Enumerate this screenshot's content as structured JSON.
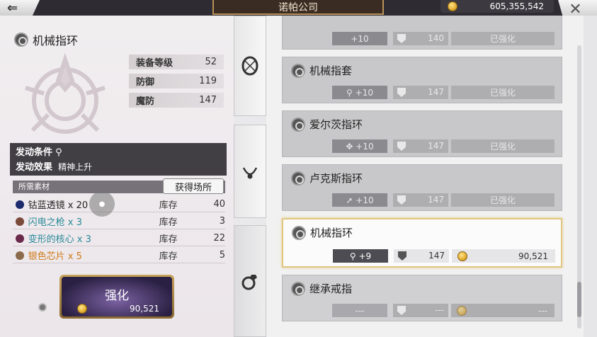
{
  "header": {
    "back_label": "⇐",
    "title": "诺帕公司",
    "currency": "605,355,542",
    "close_label": "✕"
  },
  "item": {
    "name": "机械指环",
    "stats": [
      {
        "label": "装备等级",
        "value": "52"
      },
      {
        "label": "防御",
        "value": "119"
      },
      {
        "label": "魔防",
        "value": "147"
      }
    ],
    "condition_label": "发动条件",
    "effect_label": "发动效果",
    "effect_value": "精神上升"
  },
  "materials": {
    "header": "所需素材",
    "get_button": "获得场所",
    "rows": [
      {
        "name": "钴蓝透镜 x 20",
        "stock_label": "库存",
        "qty": "40",
        "color": "#222222",
        "orb": "#1c2a6e"
      },
      {
        "name": "闪电之枪 x 3",
        "stock_label": "库存",
        "qty": "3",
        "color": "#2a8a9a",
        "orb": "#7a4a3a"
      },
      {
        "name": "变形的核心 x 3",
        "stock_label": "库存",
        "qty": "22",
        "color": "#2a8a9a",
        "orb": "#6a2a4a"
      },
      {
        "name": "银色芯片 x 5",
        "stock_label": "库存",
        "qty": "5",
        "color": "#d07a1a",
        "orb": "#8a6a4a"
      }
    ]
  },
  "enhance": {
    "label": "强化",
    "cost": "90,521"
  },
  "list": {
    "cards": [
      {
        "name": "",
        "level": "+10",
        "defense": "140",
        "status": "已强化"
      },
      {
        "name": "机械指套",
        "level": "+10",
        "defense": "147",
        "status": "已强化"
      },
      {
        "name": "爱尔茨指环",
        "level": "+10",
        "defense": "147",
        "status": "已强化"
      },
      {
        "name": "卢克斯指环",
        "level": "+10",
        "defense": "147",
        "status": "已强化"
      },
      {
        "name": "机械指环",
        "level": "+9",
        "defense": "147",
        "status": "90,521"
      },
      {
        "name": "继承戒指",
        "level": "---",
        "defense": "---",
        "status": "---"
      }
    ]
  }
}
